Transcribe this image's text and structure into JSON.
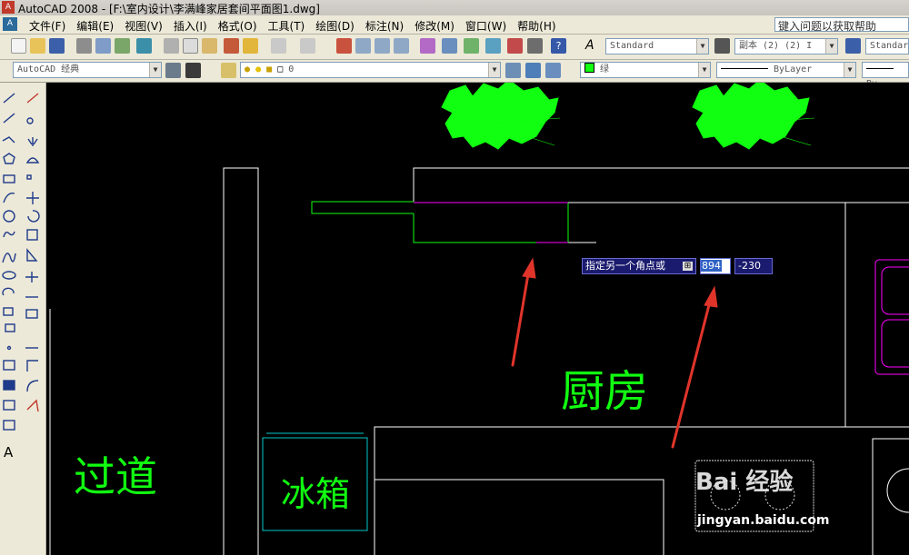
{
  "window": {
    "title": "AutoCAD 2008 - [F:\\室内设计\\李满峰家居套间平面图1.dwg]",
    "app_badge": "A"
  },
  "menu": [
    "文件(F)",
    "编辑(E)",
    "视图(V)",
    "插入(I)",
    "格式(O)",
    "工具(T)",
    "绘图(D)",
    "标注(N)",
    "修改(M)",
    "窗口(W)",
    "帮助(H)"
  ],
  "help_search": {
    "placeholder": "键入问题以获取帮助"
  },
  "toolbar": {
    "text_style": "Standard",
    "dim_style": "副本 (2) (2) I",
    "table_style": "Standar",
    "workspace": "AutoCAD 经典",
    "layer": "0",
    "color": "绿",
    "linetype": "ByLayer",
    "lineweight": "By"
  },
  "drawing": {
    "room_labels": {
      "kitchen": "厨房",
      "hallway": "过道",
      "fridge": "冰箱"
    },
    "colors": {
      "wall": "#ffffff",
      "green": "#11ff11",
      "magenta": "#ff00ff",
      "cyan": "#00c8c8",
      "arrow": "#e0342a"
    }
  },
  "dynamic_input": {
    "prompt": "指定另一个角点或",
    "value_x": "894",
    "value_y": "-230"
  },
  "watermark": {
    "logo": "Bai 经验",
    "url": "jingyan.baidu.com"
  }
}
